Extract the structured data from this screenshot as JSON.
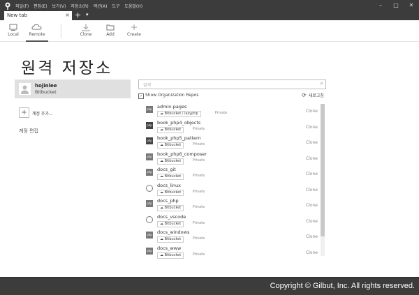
{
  "menu": [
    "파일(F)",
    "편집(E)",
    "보기(V)",
    "저장소(R)",
    "액션(A)",
    "도구",
    "도움말(H)"
  ],
  "tab": {
    "label": "New tab",
    "close": "×",
    "add": "+",
    "dropdown": "▾"
  },
  "window_buttons": {
    "minimize": "–",
    "maximize": "□",
    "close": "✕"
  },
  "toolbar": {
    "local": "Local",
    "remote": "Remote",
    "clone": "Clone",
    "add": "Add",
    "create": "Create"
  },
  "page_title": "원격 저장소",
  "account": {
    "name": "hojinlee",
    "host": "Bitbucket"
  },
  "add_account": {
    "icon": "+",
    "label": "계정 추가..."
  },
  "edit_accounts": "계정 편집",
  "search": {
    "placeholder": "검색"
  },
  "show_org_repos": {
    "label": "Show Organization Repos",
    "checked": "✓"
  },
  "refresh": {
    "label": "새로고침",
    "icon": "⟳"
  },
  "clone_label": "Clone",
  "repos": [
    {
      "name": "admin-pages",
      "host": "Bitbucket / lazyphp",
      "visibility": "Private",
      "icon": "php",
      "badge": "php"
    },
    {
      "name": "book_php4_objects",
      "host": "Bitbucket",
      "visibility": "Private",
      "icon": "php-dark",
      "badge": "php"
    },
    {
      "name": "book_php5_pattern",
      "host": "Bitbucket",
      "visibility": "Private",
      "icon": "php-dark",
      "badge": "php"
    },
    {
      "name": "book_php6_composer",
      "host": "Bitbucket",
      "visibility": "Private",
      "icon": "php",
      "badge": "php"
    },
    {
      "name": "docs_git",
      "host": "Bitbucket",
      "visibility": "Private",
      "icon": "php",
      "badge": "php"
    },
    {
      "name": "docs_linux",
      "host": "Bitbucket",
      "visibility": "Private",
      "icon": "circle",
      "badge": ""
    },
    {
      "name": "docs_php",
      "host": "Bitbucket",
      "visibility": "Private",
      "icon": "php",
      "badge": "php"
    },
    {
      "name": "docs_vscode",
      "host": "Bitbucket",
      "visibility": "Private",
      "icon": "circle",
      "badge": ""
    },
    {
      "name": "docs_windows",
      "host": "Bitbucket",
      "visibility": "Private",
      "icon": "php",
      "badge": "php"
    },
    {
      "name": "docs_www",
      "host": "Bitbucket",
      "visibility": "Private",
      "icon": "php",
      "badge": "php"
    }
  ],
  "footer": "Copyright © Gilbut, Inc. All rights reserved."
}
